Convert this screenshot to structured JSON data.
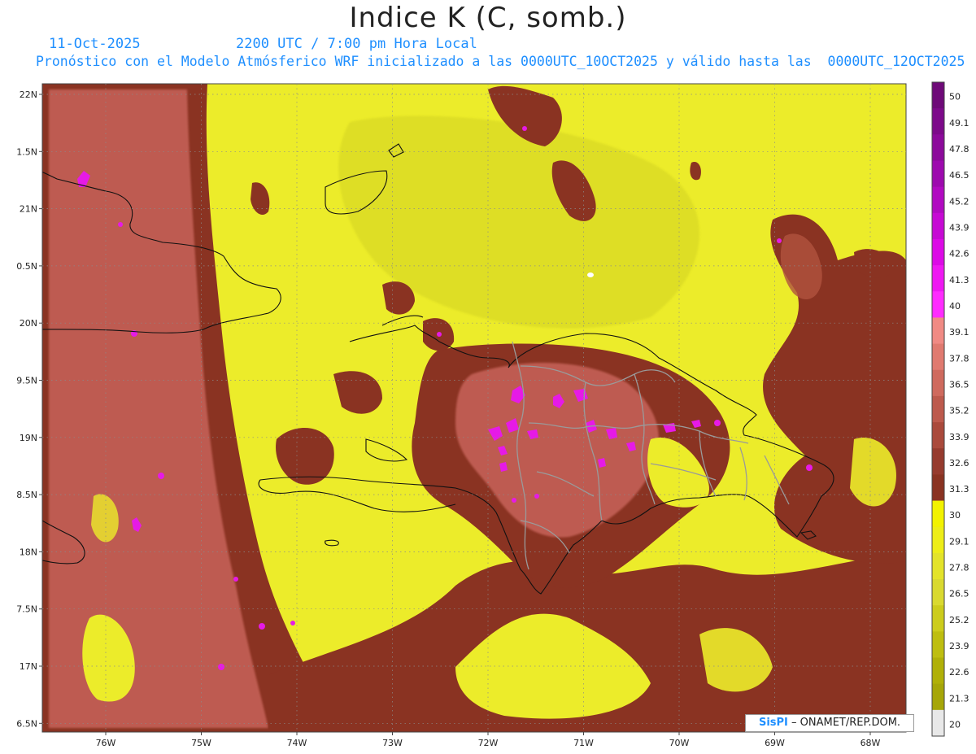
{
  "title": "Indice K (C, somb.)",
  "date": "11-Oct-2025",
  "time": "2200 UTC / 7:00 pm Hora Local",
  "description": "Pronóstico con el Modelo Atmósferico WRF inicializado a las 0000UTC_10OCT2025 y válido hasta las  0000UTC_12OCT2025",
  "credit": {
    "brand": "SisPI",
    "text": "ONAMET/REP.DOM."
  },
  "lat_labels": [
    "22N",
    "1.5N",
    "21N",
    "0.5N",
    "20N",
    "9.5N",
    "19N",
    "8.5N",
    "18N",
    "7.5N",
    "17N",
    "6.5N"
  ],
  "lon_labels": [
    "76W",
    "75W",
    "74W",
    "73W",
    "72W",
    "71W",
    "70W",
    "69W",
    "68W"
  ],
  "colorbar": {
    "levels": [
      "50",
      "49.1",
      "47.8",
      "46.5",
      "45.2",
      "43.9",
      "42.6",
      "41.3",
      "40",
      "39.1",
      "37.8",
      "36.5",
      "35.2",
      "33.9",
      "32.6",
      "31.3",
      "30",
      "29.1",
      "27.8",
      "26.5",
      "25.2",
      "23.9",
      "22.6",
      "21.3",
      "20"
    ],
    "colors": [
      "#6e0a78",
      "#7d0a8a",
      "#8c0a9b",
      "#9d0aae",
      "#b10ac1",
      "#c60ad4",
      "#dc0ae6",
      "#ee18f2",
      "#ff2bff",
      "#f08a84",
      "#e07a70",
      "#cf6a5e",
      "#bd5a4d",
      "#aa4a3c",
      "#963b2e",
      "#8a3322",
      "#f2f200",
      "#eded18",
      "#e3e32a",
      "#d9d930",
      "#cccc1c",
      "#bebe10",
      "#b0b008",
      "#a6a608",
      "#e8e8e8"
    ]
  },
  "colors": {
    "yellow": "#ecec2a",
    "brown": "#8a3322",
    "salmon": "#c8645a",
    "magenta": "#e61ae6",
    "olive": "#c8c81e"
  }
}
